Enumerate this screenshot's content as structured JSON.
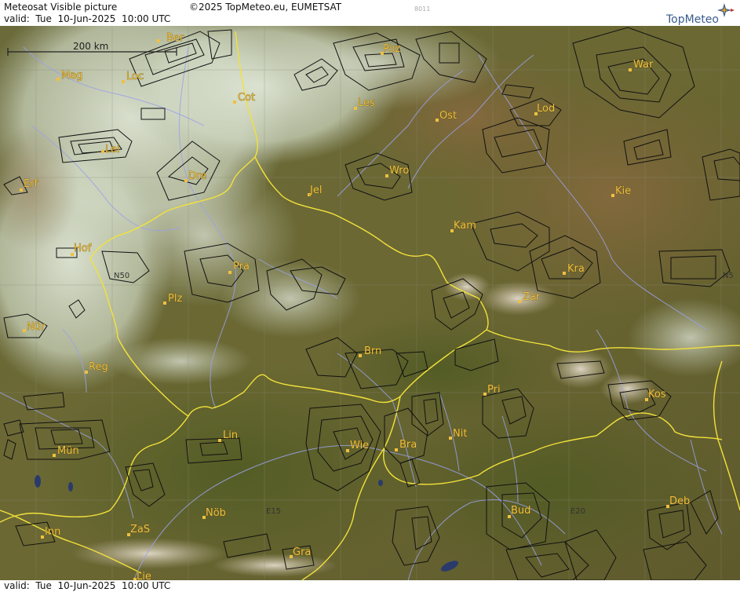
{
  "header": {
    "title": "Meteosat Visible picture",
    "copyright": "©2025 TopMeteo.eu, EUMETSAT",
    "valid": "valid:  Tue  10-Jun-2025  10:00 UTC",
    "image_id": "8011",
    "logo_text": "TopMeteo"
  },
  "footer": {
    "valid": "valid:  Tue  10-Jun-2025  10:00 UTC"
  },
  "scale": {
    "label": "200 km"
  },
  "cities": [
    "Ber",
    "Mag",
    "Loc",
    "Cot",
    "Poz",
    "War",
    "Les",
    "Lod",
    "Ost",
    "Lei",
    "Dre",
    "Wro",
    "Erf",
    "Jel",
    "Kie",
    "Kam",
    "Hof",
    "Pra",
    "Kra",
    "Zar",
    "Plz",
    "Nür",
    "Brn",
    "Reg",
    "Pri",
    "Kos",
    "Lin",
    "Wie",
    "Bra",
    "Nit",
    "Mün",
    "Inn",
    "ZaS",
    "Nöb",
    "Bud",
    "Deb",
    "Gra",
    "Lie"
  ],
  "grid_labels": [
    "N50",
    "N5",
    "E15",
    "E20"
  ],
  "colors": {
    "border": "#f2e23a",
    "river": "#9aa2e8",
    "airspace": "#111111",
    "city_label": "#f0c040"
  }
}
